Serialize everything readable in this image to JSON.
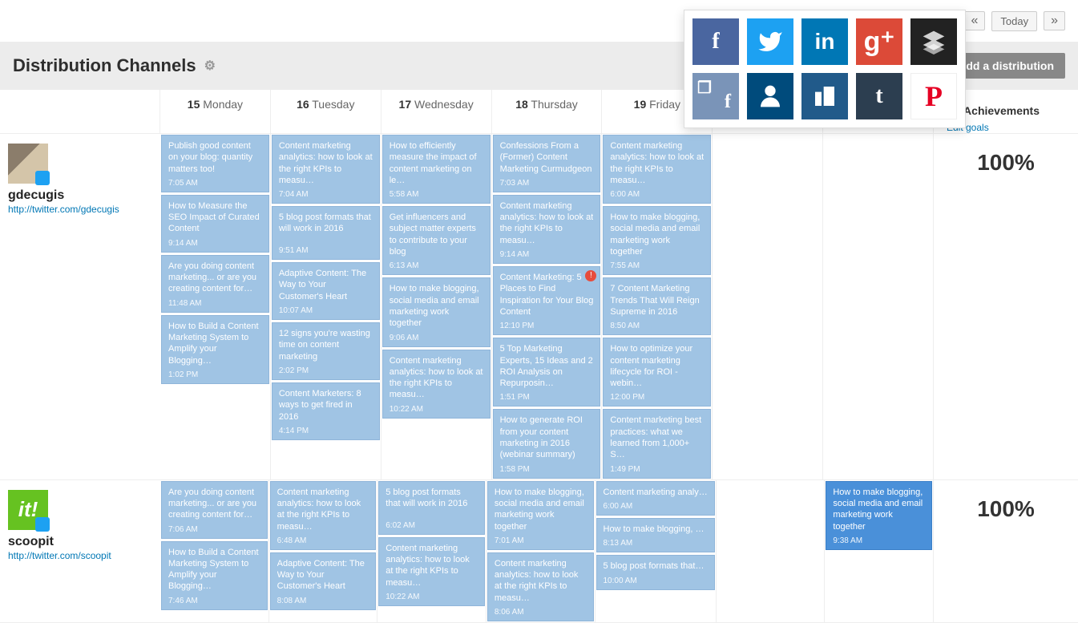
{
  "nav": {
    "prev": "«",
    "today": "Today",
    "next": "»"
  },
  "header": {
    "title": "Distribution Channels",
    "add_button": "Add a distribution"
  },
  "days": [
    {
      "num": "15",
      "name": "Monday"
    },
    {
      "num": "16",
      "name": "Tuesday"
    },
    {
      "num": "17",
      "name": "Wednesday"
    },
    {
      "num": "18",
      "name": "Thursday"
    },
    {
      "num": "19",
      "name": "Friday"
    },
    {
      "num": "",
      "name": ""
    },
    {
      "num": "",
      "name": ""
    }
  ],
  "achieve": {
    "label": "al Achievements",
    "edit": "Edit goals"
  },
  "social_icons": [
    {
      "name": "facebook",
      "color": "#4a66a0"
    },
    {
      "name": "twitter",
      "color": "#1da1f2"
    },
    {
      "name": "linkedin",
      "color": "#0077b5"
    },
    {
      "name": "googleplus",
      "color": "#dc4a38"
    },
    {
      "name": "buffer",
      "color": "#222"
    },
    {
      "name": "fb-page",
      "color": "#7a94b8"
    },
    {
      "name": "linkedin-alt",
      "color": "#004b7c"
    },
    {
      "name": "linkedin-company",
      "color": "#215a8a"
    },
    {
      "name": "tumblr",
      "color": "#2c3e50"
    },
    {
      "name": "pinterest",
      "color": "#e60023"
    }
  ],
  "channels": [
    {
      "name": "gdecugis",
      "url": "http://twitter.com/gdecugis",
      "avatar_type": "person",
      "achievement": "100%",
      "days": [
        [
          {
            "title": "Publish good content on your blog: quantity matters too!",
            "time": "7:05 AM"
          },
          {
            "title": "How to Measure the SEO Impact of Curated Content",
            "time": "9:14 AM"
          },
          {
            "title": "Are you doing content marketing... or are you creating content for…",
            "time": "11:48 AM"
          },
          {
            "title": "How to Build a Content Marketing System to Amplify your Blogging…",
            "time": "1:02 PM"
          }
        ],
        [
          {
            "title": "Content marketing analytics: how to look at the right KPIs to measu…",
            "time": "7:04 AM"
          },
          {
            "title": "5 blog post formats that will work in 2016",
            "time": "9:51 AM"
          },
          {
            "title": "Adaptive Content: The Way to Your Customer's Heart",
            "time": "10:07 AM"
          },
          {
            "title": "12 signs you're wasting time on content marketing",
            "time": "2:02 PM"
          },
          {
            "title": "Content Marketers: 8 ways to get fired in 2016",
            "time": "4:14 PM"
          }
        ],
        [
          {
            "title": "How to efficiently measure the impact of content marketing on le…",
            "time": "5:58 AM"
          },
          {
            "title": "Get influencers and subject matter experts to contribute to your blog",
            "time": "6:13 AM"
          },
          {
            "title": "How to make blogging, social media and email marketing work together",
            "time": "9:06 AM"
          },
          {
            "title": "Content marketing analytics: how to look at the right KPIs to measu…",
            "time": "10:22 AM"
          }
        ],
        [
          {
            "title": "Confessions From a (Former) Content Marketing Curmudgeon",
            "time": "7:03 AM"
          },
          {
            "title": "Content marketing analytics: how to look at the right KPIs to measu…",
            "time": "9:14 AM"
          },
          {
            "title": "Content Marketing: 5 Places to Find Inspiration for Your Blog Content",
            "time": "12:10 PM",
            "alert": true
          },
          {
            "title": "5 Top Marketing Experts, 15 Ideas and 2 ROI Analysis on Repurposin…",
            "time": "1:51 PM"
          },
          {
            "title": "How to generate ROI from your content marketing in 2016 (webinar summary)",
            "time": "1:58 PM"
          }
        ],
        [
          {
            "title": "Content marketing analytics: how to look at the right KPIs to measu…",
            "time": "6:00 AM"
          },
          {
            "title": "How to make blogging, social media and email marketing work together",
            "time": "7:55 AM"
          },
          {
            "title": "7 Content Marketing Trends That Will Reign Supreme in 2016",
            "time": "8:50 AM"
          },
          {
            "title": "How to optimize your content marketing lifecycle for ROI - webin…",
            "time": "12:00 PM"
          },
          {
            "title": "Content marketing best practices: what we learned from 1,000+ S…",
            "time": "1:49 PM"
          }
        ],
        [],
        []
      ]
    },
    {
      "name": "scoopit",
      "url": "http://twitter.com/scoopit",
      "avatar_type": "scoopit",
      "achievement": "100%",
      "days": [
        [
          {
            "title": "Are you doing content marketing... or are you creating content for…",
            "time": "7:06 AM"
          },
          {
            "title": "How to Build a Content Marketing System to Amplify your Blogging…",
            "time": "7:46 AM"
          }
        ],
        [
          {
            "title": "Content marketing analytics: how to look at the right KPIs to measu…",
            "time": "6:48 AM"
          },
          {
            "title": "Adaptive Content: The Way to Your Customer's Heart",
            "time": "8:08 AM"
          }
        ],
        [
          {
            "title": "5 blog post formats that will work in 2016",
            "time": "6:02 AM"
          },
          {
            "title": "Content marketing analytics: how to look at the right KPIs to measu…",
            "time": "10:22 AM"
          }
        ],
        [
          {
            "title": "How to make blogging, social media and email marketing work together",
            "time": "7:01 AM"
          },
          {
            "title": "Content marketing analytics: how to look at the right KPIs to measu…",
            "time": "8:06 AM"
          }
        ],
        [
          {
            "title": "Content marketing analy…",
            "time": "6:00 AM",
            "slim": true
          },
          {
            "title": "How to make blogging, …",
            "time": "8:13 AM",
            "slim": true
          },
          {
            "title": "5 blog post formats that…",
            "time": "10:00 AM",
            "slim": true
          }
        ],
        [],
        [
          {
            "title": "How to make blogging, social media and email marketing work together",
            "time": "9:38 AM",
            "dark": true
          }
        ]
      ]
    }
  ]
}
